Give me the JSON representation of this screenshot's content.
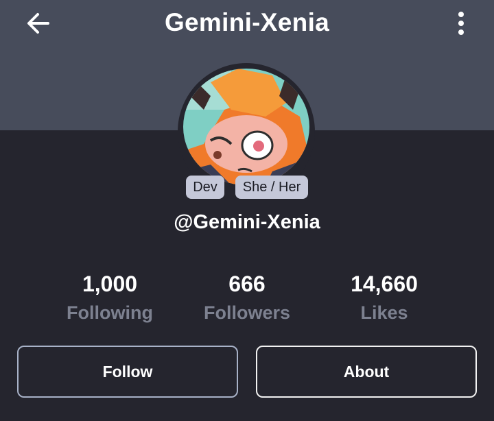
{
  "header": {
    "title": "Gemini-Xenia",
    "back_icon": "arrow-left-icon",
    "menu_icon": "kebab-menu-icon"
  },
  "profile": {
    "handle": "@Gemini-Xenia",
    "badges": [
      "Dev",
      "She / Her"
    ]
  },
  "stats": [
    {
      "value": "1,000",
      "label": "Following"
    },
    {
      "value": "666",
      "label": "Followers"
    },
    {
      "value": "14,660",
      "label": "Likes"
    }
  ],
  "actions": {
    "follow_label": "Follow",
    "about_label": "About"
  },
  "colors": {
    "background": "#25252e",
    "header": "#474c5b",
    "badge": "#c5c8d9",
    "muted_text": "#7d8190"
  }
}
